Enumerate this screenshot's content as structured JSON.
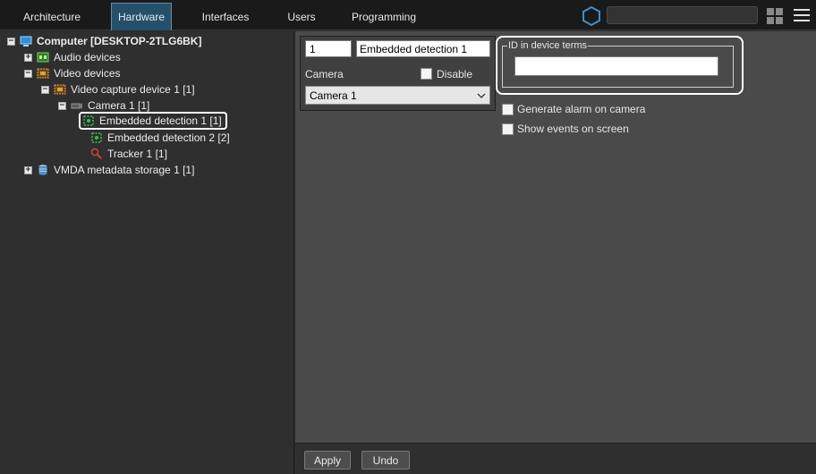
{
  "tabs": [
    {
      "label": "Architecture"
    },
    {
      "label": "Hardware"
    },
    {
      "label": "Interfaces"
    },
    {
      "label": "Users"
    },
    {
      "label": "Programming"
    }
  ],
  "active_tab": "Hardware",
  "search": {
    "value": "",
    "placeholder": ""
  },
  "tree": {
    "computer": "Computer [DESKTOP-2TLG6BK]",
    "audio_devices": "Audio devices",
    "video_devices": "Video devices",
    "video_capture_device": "Video capture device 1 [1]",
    "camera": "Camera 1 [1]",
    "embedded_detection_1": "Embedded detection 1 [1]",
    "embedded_detection_2": "Embedded detection 2 [2]",
    "tracker": "Tracker 1 [1]",
    "vmda_storage": "VMDA metadata storage 1 [1]"
  },
  "selected_node": "Embedded detection 1 [1]",
  "properties": {
    "id_value": "1",
    "name_value": "Embedded detection 1",
    "camera_label": "Camera",
    "disable_label": "Disable",
    "disable_checked": false,
    "camera_selected": "Camera 1",
    "id_in_device_terms_label": "ID in device terms",
    "id_in_device_terms_value": "",
    "generate_alarm_label": "Generate alarm on camera",
    "generate_alarm_checked": false,
    "show_events_label": "Show events on screen",
    "show_events_checked": false
  },
  "buttons": {
    "apply": "Apply",
    "undo": "Undo"
  },
  "colors": {
    "accent_tab": "#24506b",
    "hex_icon": "#3d8fd1",
    "highlight_border": "#ffffff"
  }
}
